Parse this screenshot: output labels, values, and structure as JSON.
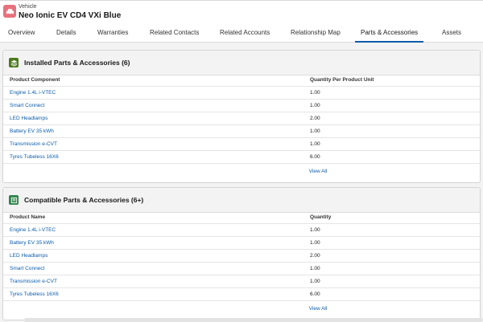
{
  "record": {
    "type_label": "Vehicle",
    "title": "Neo Ionic EV CD4 VXi Blue",
    "icon": "car-icon",
    "icon_color": "#e8717e"
  },
  "tabs": [
    {
      "label": "Overview",
      "active": false
    },
    {
      "label": "Details",
      "active": false
    },
    {
      "label": "Warranties",
      "active": false
    },
    {
      "label": "Related Contacts",
      "active": false
    },
    {
      "label": "Related Accounts",
      "active": false
    },
    {
      "label": "Relationship Map",
      "active": false
    },
    {
      "label": "Parts & Accessories",
      "active": true
    },
    {
      "label": "Assets",
      "active": false
    }
  ],
  "installed": {
    "title": "Installed Parts & Accessories (6)",
    "icon": "parts-icon",
    "icon_color": "#4c7a1d",
    "columns": [
      "Product Component",
      "Quantity Per Product Unit"
    ],
    "rows": [
      {
        "name": "Engine 1.4L i-VTEC",
        "qty": "1.00"
      },
      {
        "name": "Smart Connect",
        "qty": "1.00"
      },
      {
        "name": "LED Headlamps",
        "qty": "2.00"
      },
      {
        "name": "Battery EV 35 kWh",
        "qty": "1.00"
      },
      {
        "name": "Transmission e-CVT",
        "qty": "1.00"
      },
      {
        "name": "Tyres Tubeless 16X6",
        "qty": "6.00"
      }
    ],
    "view_all": "View All"
  },
  "compatible": {
    "title": "Compatible Parts & Accessories (6+)",
    "icon": "list-icon",
    "icon_color": "#2e844a",
    "columns": [
      "Product Name",
      "Quantity"
    ],
    "rows": [
      {
        "name": "Engine 1.4L i-VTEC",
        "qty": "1.00"
      },
      {
        "name": "Battery EV 35 kWh",
        "qty": "1.00"
      },
      {
        "name": "LED Headlamps",
        "qty": "2.00"
      },
      {
        "name": "Smart Connect",
        "qty": "1.00"
      },
      {
        "name": "Transmission e-CVT",
        "qty": "1.00"
      },
      {
        "name": "Tyres Tubeless 16X6",
        "qty": "6.00"
      }
    ],
    "view_all": "View All"
  }
}
